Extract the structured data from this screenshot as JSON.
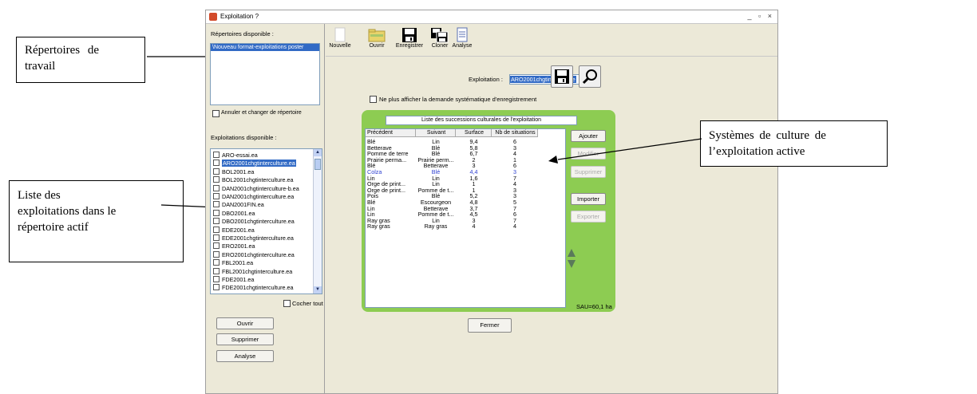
{
  "annotations": {
    "repertoires": [
      "Répertoires   de",
      "travail"
    ],
    "liste": [
      "Liste des",
      "exploitations dans le",
      "répertoire actif"
    ],
    "systemes": [
      "Systèmes  de  culture  de",
      "l’exploitation active"
    ]
  },
  "window": {
    "title": "Exploitation  ?",
    "controls": "_ ▫ ×"
  },
  "left": {
    "rep_label": "Répertoires disponible :",
    "rep_selected": "\\Nouveau format-exploitations poster",
    "annuler_label": "Annuler et changer de répertoire",
    "exp_label": "Exploitations disponible :",
    "exploitations": [
      "ARO-essai.ea",
      "ARO2001chgtinterculture.ea",
      "BOL2001.ea",
      "BOL2001chgtinterculture.ea",
      "DAN2001chgtinterculture-b.ea",
      "DAN2001chgtinterculture.ea",
      "DAN2001FIN.ea",
      "DBO2001.ea",
      "DBO2001chgtinterculture.ea",
      "EDE2001.ea",
      "EDE2001chgtinterculture.ea",
      "ERO2001.ea",
      "ERO2001chgtinterculture.ea",
      "FBL2001.ea",
      "FBL2001chgtinterculture.ea",
      "FDE2001.ea",
      "FDE2001chgtinterculture.ea"
    ],
    "cocher_tout": "Cocher tout",
    "btn_ouvrir": "Ouvrir",
    "btn_supprimer": "Supprimer",
    "btn_analyse": "Analyse"
  },
  "toolbar": {
    "nouvelle": "Nouvelle",
    "ouvrir": "Ouvrir",
    "enregistrer": "Enregistrer",
    "cloner": "Cloner",
    "analyse": "Analyse"
  },
  "main": {
    "exploitation_label": "Exploitation :",
    "exploitation_value": "ARO2001chgtinterculture",
    "ne_plus": "Ne plus afficher la demande systématique d'enregistrement",
    "liste_title": "Liste des successions culturales de l'exploitation",
    "columns": [
      "Précédent",
      "Suivant",
      "Surface",
      "Nb de situations"
    ],
    "rows": [
      [
        "Blé",
        "Lin",
        "9,4",
        "6"
      ],
      [
        "Betterave",
        "Blé",
        "5,8",
        "3"
      ],
      [
        "Pomme de terre",
        "Blé",
        "6,7",
        "4"
      ],
      [
        "Prairie perma...",
        "Prairie perm...",
        "2",
        "1"
      ],
      [
        "Blé",
        "Betterave",
        "3",
        "6"
      ],
      [
        "Colza",
        "Blé",
        "4,4",
        "3"
      ],
      [
        "Lin",
        "Lin",
        "1,6",
        "7"
      ],
      [
        "Orge de print...",
        "Lin",
        "1",
        "4"
      ],
      [
        "Orge de print...",
        "Pomme de t...",
        "1",
        "3"
      ],
      [
        "Pois",
        "Blé",
        "5,2",
        "3"
      ],
      [
        "Blé",
        "Escourgeon",
        "4,8",
        "5"
      ],
      [
        "Lin",
        "Betterave",
        "3,7",
        "7"
      ],
      [
        "Lin",
        "Pomme de t...",
        "4,5",
        "6"
      ],
      [
        "Ray gras",
        "Lin",
        "3",
        "7"
      ],
      [
        "Ray gras",
        "Ray gras",
        "4",
        "4"
      ]
    ],
    "highlight_row_color": "#2d3fd0",
    "btn_ajouter": "Ajouter",
    "btn_modifier": "Modifier",
    "btn_supprimer": "Supprimer",
    "btn_importer": "Importer",
    "btn_exporter": "Exporter",
    "sau": "SAU=60,1 ha",
    "btn_fermer": "Fermer"
  },
  "colors": {
    "selection": "#316ac5",
    "panel_green": "#8dcc52",
    "window_bg": "#ece9d8"
  }
}
